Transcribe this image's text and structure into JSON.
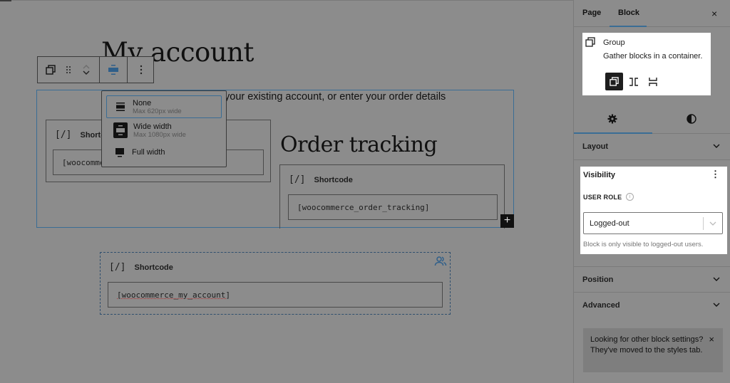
{
  "canvas": {
    "page_title": "My account",
    "intro_text": "your existing account, or enter your order details",
    "order_tracking_title": "Order tracking",
    "shortcode_left": {
      "label": "Shortcode",
      "icon": "[/]",
      "value": "[woocommerce_my_account]"
    },
    "shortcode_right": {
      "label": "Shortcode",
      "icon": "[/]",
      "value": "[woocommerce_order_tracking]"
    },
    "shortcode_bottom": {
      "label": "Shortcode",
      "icon": "[/]",
      "value": "[woocommerce_my_account]"
    },
    "add_block": "+"
  },
  "toolbar": {
    "buttons": [
      "group-icon",
      "drag-handle-icon",
      "move-up-icon",
      "move-down-icon",
      "align-icon",
      "more-options-icon"
    ]
  },
  "align_menu": {
    "items": [
      {
        "label": "None",
        "sub": "Max 620px wide",
        "active": true
      },
      {
        "label": "Wide width",
        "sub": "Max 1080px wide",
        "active": false
      },
      {
        "label": "Full width",
        "sub": "",
        "active": false
      }
    ]
  },
  "sidebar": {
    "tabs": [
      {
        "label": "Page"
      },
      {
        "label": "Block",
        "active": true
      }
    ],
    "close": "×",
    "block_card": {
      "title": "Group",
      "description": "Gather blocks in a container."
    },
    "subtabs": [
      "settings-icon",
      "styles-icon"
    ],
    "panels": {
      "layout": "Layout",
      "position": "Position",
      "advanced": "Advanced"
    },
    "visibility": {
      "title": "Visibility",
      "more": "⋮",
      "user_role_label": "USER ROLE",
      "info": "i",
      "selected": "Logged-out",
      "help": "Block is only visible to logged-out users."
    },
    "notice": {
      "text": "Looking for other block settings? They've moved to the styles tab.",
      "close": "×"
    }
  },
  "colors": {
    "accent": "#3a6d95",
    "overlay_bg": "#8c8c8c",
    "card_bg": "#ffffff",
    "dark": "#1e1e1e"
  }
}
